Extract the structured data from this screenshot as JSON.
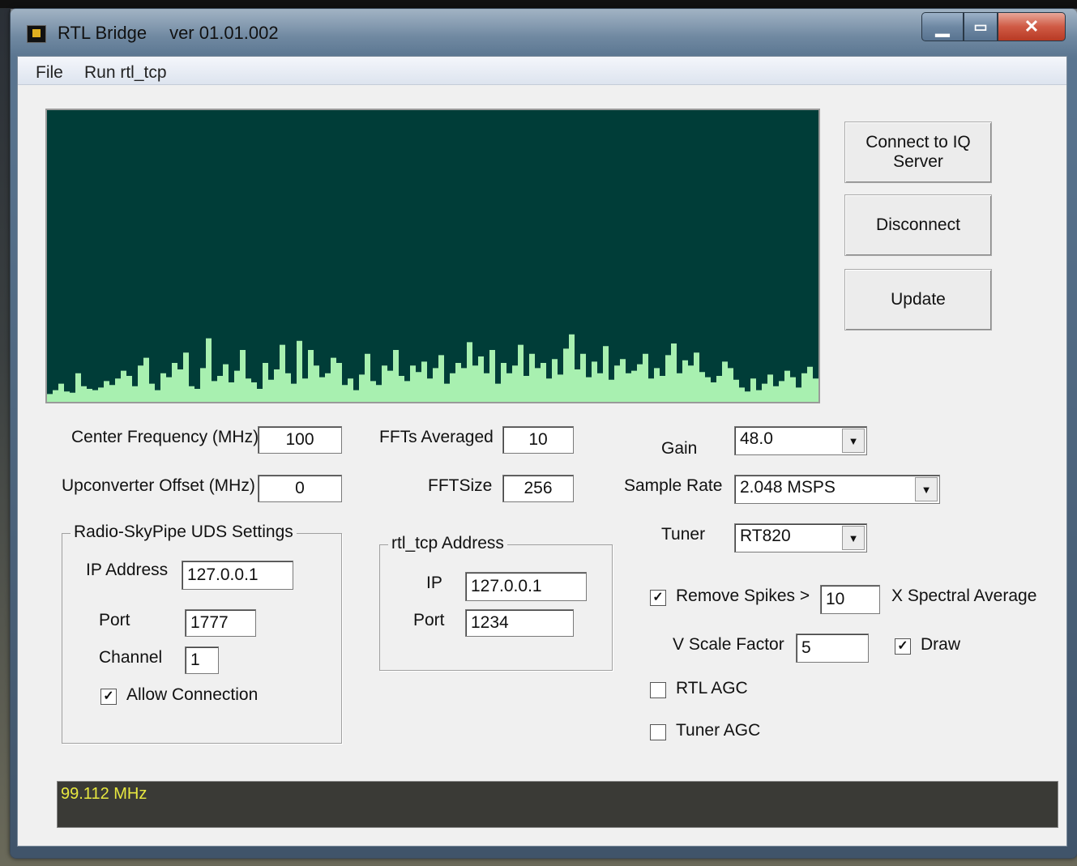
{
  "window": {
    "title": "RTL Bridge",
    "version": "ver 01.01.002"
  },
  "menu": {
    "file": "File",
    "run": "Run rtl_tcp"
  },
  "buttons": {
    "connect": "Connect to IQ Server",
    "disconnect": "Disconnect",
    "update": "Update"
  },
  "settings": {
    "center_freq_label": "Center Frequency (MHz)",
    "center_freq_value": "100",
    "upconverter_label": "Upconverter Offset (MHz)",
    "upconverter_value": "0",
    "ffts_avg_label": "FFTs Averaged",
    "ffts_avg_value": "10",
    "fft_size_label": "FFTSize",
    "fft_size_value": "256",
    "gain_label": "Gain",
    "gain_value": "48.0",
    "sample_rate_label": "Sample Rate",
    "sample_rate_value": "2.048 MSPS",
    "tuner_label": "Tuner",
    "tuner_value": "RT820"
  },
  "uds": {
    "legend": "Radio-SkyPipe UDS Settings",
    "ip_label": "IP Address",
    "ip_value": "127.0.0.1",
    "port_label": "Port",
    "port_value": "1777",
    "channel_label": "Channel",
    "channel_value": "1",
    "allow_label": "Allow Connection",
    "allow_checked": true
  },
  "rtl_tcp": {
    "legend": "rtl_tcp Address",
    "ip_label": "IP",
    "ip_value": "127.0.0.1",
    "port_label": "Port",
    "port_value": "1234"
  },
  "options": {
    "remove_spikes_label": "Remove Spikes >",
    "remove_spikes_value": "10",
    "remove_spikes_checked": true,
    "spectral_avg_label": "X Spectral Average",
    "vscale_label": "V Scale Factor",
    "vscale_value": "5",
    "draw_label": "Draw",
    "draw_checked": true,
    "rtl_agc_label": "RTL AGC",
    "rtl_agc_checked": false,
    "tuner_agc_label": "Tuner AGC",
    "tuner_agc_checked": false
  },
  "status": {
    "text": "99.112 MHz"
  },
  "colors": {
    "spectrum_bg": "#003d38",
    "spectrum_fill": "#a8f0b0",
    "status_text": "#e8e840"
  },
  "spectrum_levels": [
    6,
    9,
    14,
    8,
    7,
    22,
    12,
    10,
    9,
    11,
    16,
    13,
    18,
    24,
    20,
    12,
    28,
    34,
    14,
    9,
    22,
    19,
    30,
    25,
    38,
    12,
    10,
    26,
    49,
    16,
    20,
    29,
    15,
    24,
    40,
    18,
    15,
    10,
    30,
    17,
    25,
    44,
    22,
    14,
    47,
    18,
    40,
    28,
    19,
    22,
    34,
    30,
    13,
    18,
    9,
    21,
    37,
    16,
    13,
    28,
    24,
    40,
    20,
    16,
    28,
    23,
    31,
    18,
    26,
    36,
    14,
    22,
    30,
    26,
    46,
    28,
    35,
    22,
    40,
    14,
    30,
    22,
    28,
    44,
    20,
    37,
    26,
    30,
    18,
    33,
    21,
    41,
    52,
    25,
    37,
    19,
    31,
    22,
    43,
    17,
    28,
    33,
    22,
    24,
    29,
    37,
    18,
    26,
    20,
    36,
    45,
    22,
    32,
    28,
    38,
    23,
    19,
    15,
    20,
    31,
    26,
    17,
    11,
    8,
    18,
    9,
    14,
    21,
    12,
    16,
    24,
    19,
    11,
    22,
    27,
    18
  ]
}
